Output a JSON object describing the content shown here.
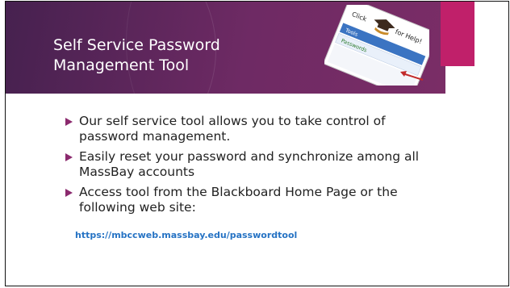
{
  "slide": {
    "title": "Self Service Password Management Tool",
    "bullets": [
      "Our self service tool allows you to take control of password management.",
      "Easily reset your password and synchronize among all MassBay accounts",
      "Access tool from the Blackboard Home Page or the following web site:"
    ],
    "link": "https://mbccweb.massbay.edu/passwordtool"
  },
  "help_graphic": {
    "caption_left": "Click",
    "caption_right": "for Help!",
    "menu_items": [
      "Tools",
      "Passwords"
    ],
    "icon": "graduation-cap-icon"
  },
  "colors": {
    "banner": "#5b2559",
    "accent": "#c0206a",
    "bullet": "#8b2a6e",
    "link": "#2673c4"
  }
}
